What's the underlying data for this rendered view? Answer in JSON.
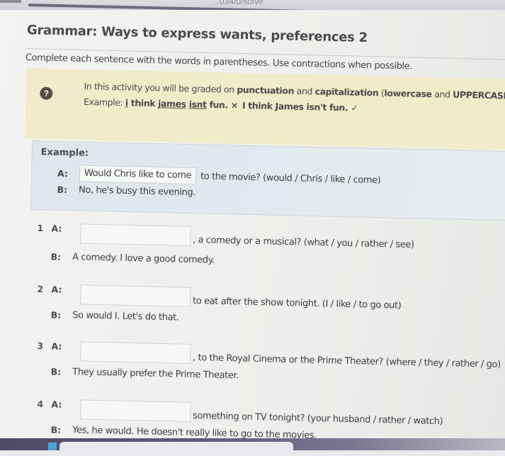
{
  "browser": {
    "url_fragment": "...034/0/solve"
  },
  "page": {
    "title": "Grammar: Ways to express wants, preferences 2",
    "instructions": "Complete each sentence with the words in parentheses. Use contractions when possible."
  },
  "notice": {
    "icon": "question-circle-icon",
    "line1_pre": "In this activity you will be graded on ",
    "line1_bold1": "punctuation",
    "line1_mid": " and ",
    "line1_bold2": "capitalization",
    "line1_paren_open": " (",
    "line1_bold3": "lowercase",
    "line1_and": " and ",
    "line1_bold4": "UPPERCASE",
    "line1_close": ").",
    "example_label": "Example: ",
    "wrong_part1": "i",
    "wrong_part2": " think j",
    "wrong_part3": "ames",
    "wrong_part4": " ",
    "wrong_part5": "isnt",
    "wrong_part6": " fun.",
    "wrong_mark": "×",
    "correct": "I think James isn't fun.",
    "correct_mark": "✓"
  },
  "example": {
    "label": "Example:",
    "a_speaker": "A:",
    "a_answer": "Would Chris like to come",
    "a_rest": "to the movie? (would / Chris / like / come)",
    "b_speaker": "B:",
    "b_text": "No, he's busy this evening."
  },
  "items": [
    {
      "number": "1",
      "a_speaker": "A:",
      "answer": "",
      "a_rest": ", a comedy or a musical? (what / you / rather / see)",
      "b_speaker": "B:",
      "b_text": "A comedy. I love a good comedy."
    },
    {
      "number": "2",
      "a_speaker": "A:",
      "answer": "",
      "a_rest": "to eat after the show tonight. (I / like / to go out)",
      "b_speaker": "B:",
      "b_text": "So would I. Let's do that."
    },
    {
      "number": "3",
      "a_speaker": "A:",
      "answer": "",
      "a_rest": ", to the Royal Cinema or the Prime Theater? (where / they / rather / go)",
      "b_speaker": "B:",
      "b_text": "They usually prefer the Prime Theater."
    },
    {
      "number": "4",
      "a_speaker": "A:",
      "answer": "",
      "a_rest": "something on TV tonight? (your husband / rather / watch)",
      "b_speaker": "B:",
      "b_text": "Yes, he would. He doesn't really like to go to the movies."
    }
  ],
  "colors": {
    "notice_bg": "#efeccb",
    "example_bg": "#e1e8ed",
    "help_icon": "#5a4a44",
    "taskbar": "#5f5a7a"
  }
}
